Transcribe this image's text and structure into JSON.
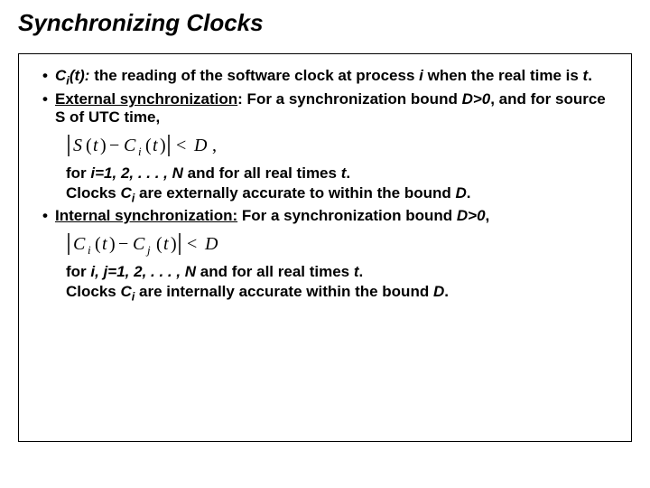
{
  "title": "Synchronizing Clocks",
  "b1": {
    "lead": "C",
    "sub": "i",
    "leadTail": "(t):",
    "rest": " the reading of the software clock at process ",
    "ivar": "i",
    "rest2": " when the real time is ",
    "tvar": "t",
    "dot": "."
  },
  "b2": {
    "head": "External synchronization",
    "rest": ": For a synchronization bound ",
    "dexpr": "D>0",
    "rest2": ", and for source S of UTC time,"
  },
  "line1a": "for ",
  "line1b": "i=1, 2, . . . , N",
  "line1c": " and for all real times ",
  "line1d": "t",
  "line1e": ".",
  "line2a": "Clocks ",
  "line2b": "C",
  "line2c": "i",
  "line2d": " are externally accurate to within the bound ",
  "line2e": "D",
  "line2f": ".",
  "b3": {
    "head": "Internal synchronization:",
    "rest": " For a synchronization bound ",
    "dexpr": "D>0",
    "rest2": ","
  },
  "line3a": "for ",
  "line3b": "i, j=1, 2, . . . , N",
  "line3c": " and for all real times ",
  "line3d": "t",
  "line3e": ".",
  "line4a": "Clocks ",
  "line4b": "C",
  "line4c": "i",
  "line4d": " are internally accurate within the bound ",
  "line4e": "D",
  "line4f": "."
}
